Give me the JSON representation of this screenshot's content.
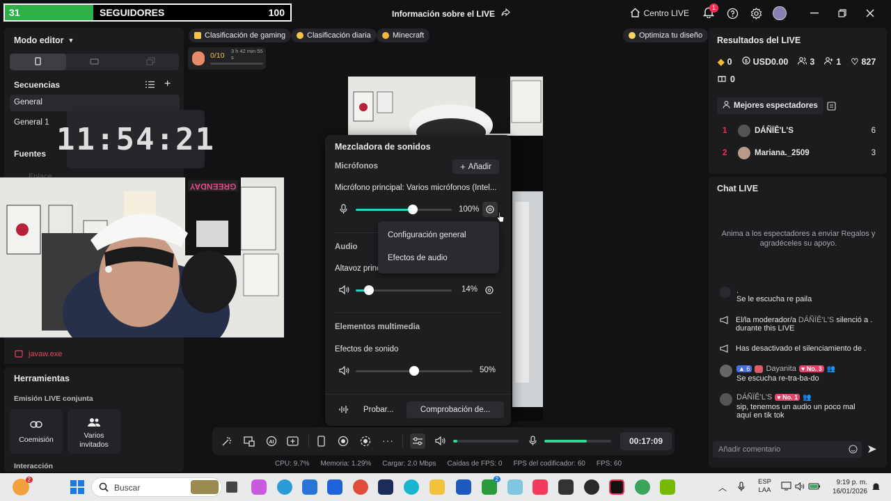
{
  "topbar": {
    "followers_count": "31",
    "followers_label": "SEGUIDORES",
    "followers_goal": "100",
    "followers_progress": 0.31,
    "live_info": "Información sobre el LIVE",
    "centro_live": "Centro LIVE",
    "notif_badge": "1"
  },
  "left": {
    "modo_editor": "Modo editor",
    "secuencias": "Secuencias",
    "seq_items": [
      "General",
      "General 1"
    ],
    "fuentes": "Fuentes",
    "fuente_faded": "Enlace",
    "clock": "11:54:21",
    "javaw": "javaw.exe",
    "herramientas": "Herramientas",
    "emision": "Emisión LIVE conjunta",
    "coemision": "Coemisión",
    "varios_1": "Varios",
    "varios_2": "invitados",
    "interaccion": "Interacción"
  },
  "center": {
    "pills": [
      "Clasificación de gaming",
      "Clasificación diaria",
      "Minecraft"
    ],
    "optimiza": "Optimiza tu diseño",
    "goal_progress": "0/10",
    "goal_timer": "3 h 42 min 55 s",
    "poster_text": "GREENDAY"
  },
  "mixer": {
    "title": "Mezcladora de sonidos",
    "microfonos": "Micrófonos",
    "anadir": "Añadir",
    "mic_name": "Micrófono principal: Varios micrófonos (Intel...",
    "mic_pct": "100%",
    "mic_level": 0.82,
    "audio": "Audio",
    "altavoz": "Altavoz princ",
    "speaker_pct": "14%",
    "speaker_level": 0.14,
    "media": "Elementos multimedia",
    "efectos": "Efectos de sonido",
    "efectos_pct": "50%",
    "efectos_level": 0.5,
    "probar": "Probar...",
    "comprobacion": "Comprobación de...",
    "menu": [
      "Configuración general",
      "Efectos de audio"
    ]
  },
  "toolbar": {
    "time": "00:17:09",
    "speaker_level": 0.02,
    "mic_level": 0.6
  },
  "stats": {
    "cpu": "CPU: 9.7%",
    "mem": "Memoria: 1.29%",
    "load": "Cargar: 2.0 Mbps",
    "fps_drop": "Caídas de FPS: 0",
    "enc_fps": "FPS del codificador: 60",
    "fps": "FPS: 60"
  },
  "right": {
    "resultados": "Resultados del LIVE",
    "stat_gem": "0",
    "stat_usd": "USD0.00",
    "stat_viewers": "3",
    "stat_follow": "1",
    "stat_likes": "827",
    "stat_gift": "0",
    "mejores": "Mejores espectadores",
    "top": [
      {
        "rank": "1",
        "name": "DÁÑÏÊ'L'S",
        "score": "6"
      },
      {
        "rank": "2",
        "name": "Mariana._2509",
        "score": "3"
      }
    ],
    "chat_title": "Chat LIVE",
    "chat_hint": "Anima a los espectadores a enviar Regalos y agradéceles su apoyo.",
    "chat_dot": ".",
    "msg1": "Se le escucha re paila",
    "msg2a": "El/la moderador/a ",
    "msg2b": "DÁÑÏÊ'L'S",
    "msg2c": " silenció a .",
    "msg2d": "durante this LIVE",
    "msg3": "Has desactivado el silenciamiento de .",
    "dayanita_lvl": "6",
    "dayanita": "Dayanita",
    "dayanita_badge": "No. 3",
    "msg4": "Se escucha re-tra-ba-do",
    "daniel": "DÁÑÏÊ'L'S",
    "daniel_badge": "No. 1",
    "msg5a": "sip, tenemos un audio un poco mal",
    "msg5b": "aquí en tik tok",
    "comment_placeholder": "Añadir comentario"
  },
  "taskbar": {
    "search": "Buscar",
    "lang1": "ESP",
    "lang2": "LAA",
    "time": "9:19 p. m.",
    "date": "16/01/2026",
    "weather_badge": "2",
    "xbox_badge": "2"
  }
}
